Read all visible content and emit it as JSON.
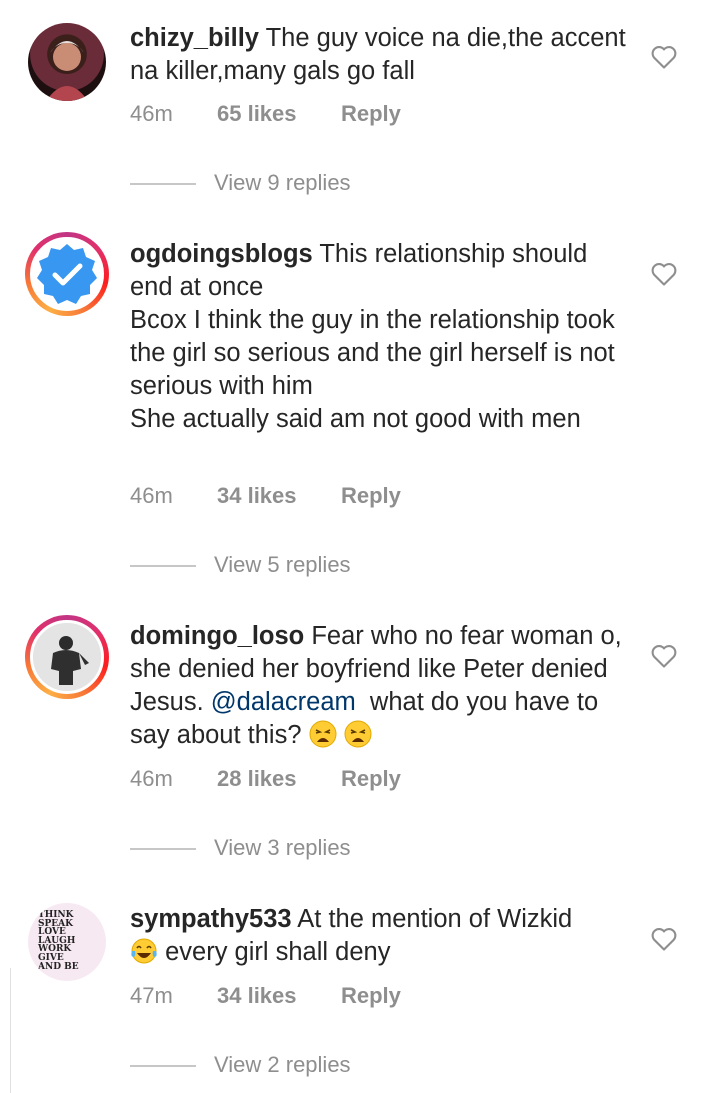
{
  "comments": [
    {
      "username": "chizy_billy",
      "text_parts": [
        "The guy voice na die,the accent na killer,many gals go fall"
      ],
      "time": "46m",
      "likes": "65 likes",
      "reply": "Reply",
      "view_replies": "View 9 replies"
    },
    {
      "username": "ogdoingsblogs",
      "text_parts": [
        "This relationship should end at once",
        "Bcox I think the guy in the relationship took the girl so serious and the girl herself is not serious with him",
        "She actually said am not good with men"
      ],
      "time": "46m",
      "likes": "34 likes",
      "reply": "Reply",
      "view_replies": "View 5 replies"
    },
    {
      "username": "domingo_loso",
      "text_before": "Fear who no fear woman o, she denied her boyfriend like Peter denied Jesus.",
      "mention": "@dalacream",
      "text_after": "what do you have to say about this?",
      "time": "46m",
      "likes": "28 likes",
      "reply": "Reply",
      "view_replies": "View 3 replies"
    },
    {
      "username": "sympathy533",
      "text_before": "At the mention of Wizkid",
      "text_after": "every girl shall deny",
      "time": "47m",
      "likes": "34 likes",
      "reply": "Reply",
      "view_replies": "View 2 replies"
    }
  ],
  "avatar4_text": [
    "THINK",
    "SPEAK",
    "LOVE",
    "LAUGH",
    "WORK",
    "GIVE",
    "AND BE"
  ],
  "colors": {
    "text": "#262626",
    "meta": "#8e8e8e",
    "mention": "#00376b",
    "verified": "#3897f0"
  },
  "icons": {
    "like": "heart-outline-icon",
    "verified": "verified-badge-icon",
    "emoji_weary": "weary-face-emoji",
    "emoji_laugh": "tears-of-joy-emoji"
  }
}
